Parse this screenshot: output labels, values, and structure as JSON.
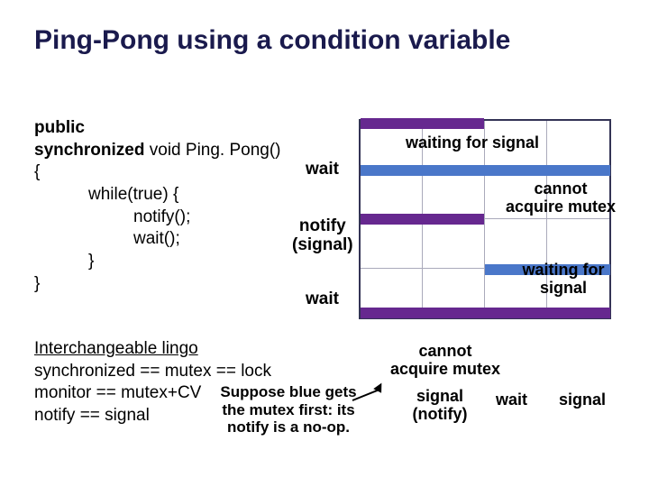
{
  "title": "Ping-Pong using a condition variable",
  "code": {
    "l1a": "public",
    "l2a": "synchronized",
    "l2b": " void Ping. Pong()",
    "l3": "{",
    "l4": "while(true) {",
    "l5": "notify();",
    "l6": "wait();",
    "l7": "}",
    "l8": "}"
  },
  "lingo": {
    "heading": "Interchangeable lingo",
    "l1": "synchronized == mutex == lock",
    "l2": "monitor == mutex+CV",
    "l3": "notify == signal"
  },
  "footnote": "Suppose blue gets the mutex first: its notify is a no-op.",
  "mid": {
    "wait1": "wait",
    "notify_l1": "notify",
    "notify_l2": "(signal)",
    "wait2": "wait"
  },
  "grid_labels": {
    "waiting_top": "waiting for signal",
    "cannot_r_l1": "cannot",
    "cannot_r_l2": "acquire mutex",
    "waiting_r_l1": "waiting for",
    "waiting_r_l2": "signal",
    "cannot_b_l1": "cannot",
    "cannot_b_l2": "acquire mutex",
    "signal_l1": "signal",
    "signal_l2": "(notify)",
    "wait_b": "wait",
    "signal_r": "signal"
  }
}
